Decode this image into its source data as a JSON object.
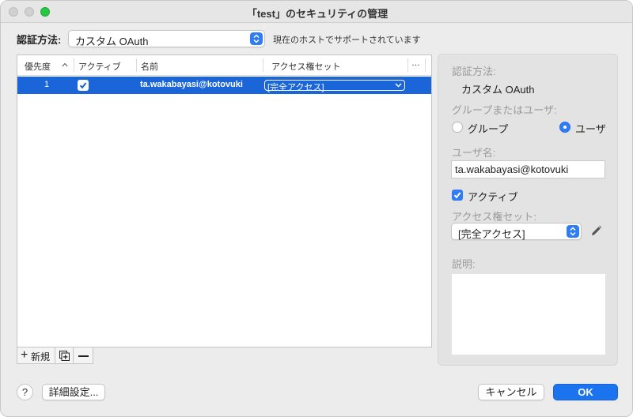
{
  "window": {
    "title": "「test」のセキュリティの管理"
  },
  "auth": {
    "label": "認証方法:",
    "selected": "カスタム OAuth",
    "hint": "現在のホストでサポートされています"
  },
  "table": {
    "columns": [
      "優先度",
      "アクティブ",
      "名前",
      "アクセス権セット",
      "…"
    ],
    "rows": [
      {
        "priority": "1",
        "active": true,
        "name": "ta.wakabayasi@kotovuki",
        "access_set": "[完全アクセス]"
      }
    ],
    "new_label": "新規"
  },
  "panel": {
    "auth_method_label": "認証方法:",
    "auth_method_value": "カスタム OAuth",
    "group_or_user_label": "グループまたはユーザ:",
    "radio_group": "グループ",
    "radio_user": "ユーザ",
    "radio_selected": "ユーザ",
    "username_label": "ユーザ名:",
    "username_value": "ta.wakabayasi@kotovuki",
    "active_label": "アクティブ",
    "active_checked": true,
    "access_set_label": "アクセス権セット:",
    "access_set_value": "[完全アクセス]",
    "description_label": "説明:",
    "description_value": ""
  },
  "buttons": {
    "help": "?",
    "advanced": "詳細設定...",
    "cancel": "キャンセル",
    "ok": "OK"
  },
  "colors": {
    "accent": "#2f7cf6",
    "selection": "#1a66d8",
    "ok_button": "#1b73f0"
  }
}
